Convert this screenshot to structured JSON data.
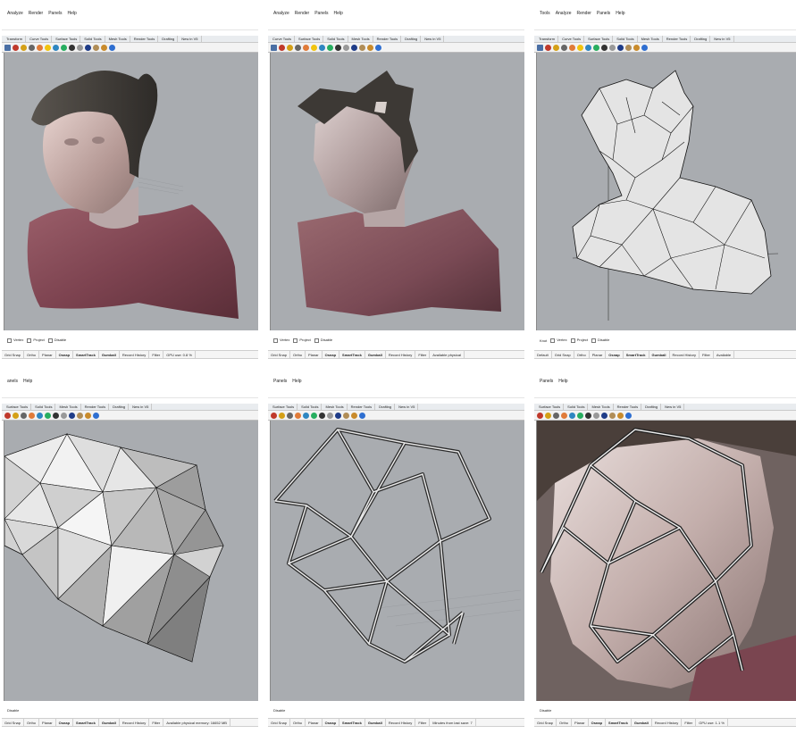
{
  "panels": [
    {
      "menu": [
        "Analyze",
        "Render",
        "Panels",
        "Help"
      ],
      "tabs": [
        "Transform",
        "Curve Tools",
        "Surface Tools",
        "Solid Tools",
        "Mesh Tools",
        "Render Tools",
        "Drafting",
        "New in V5"
      ],
      "osnap": [
        "Vertex",
        "Project",
        "Disable"
      ],
      "status": [
        "Grid Snap",
        "Ortho",
        "Planar",
        "Osnap",
        "SmartTrack",
        "Gumball",
        "Record History",
        "Filter",
        "GPU use: 0.8 %"
      ]
    },
    {
      "menu": [
        "Analyze",
        "Render",
        "Panels",
        "Help"
      ],
      "tabs": [
        "Curve Tools",
        "Surface Tools",
        "Solid Tools",
        "Mesh Tools",
        "Render Tools",
        "Drafting",
        "New in V5"
      ],
      "osnap": [
        "Vertex",
        "Project",
        "Disable"
      ],
      "status": [
        "Grid Snap",
        "Ortho",
        "Planar",
        "Osnap",
        "SmartTrack",
        "Gumball",
        "Record History",
        "Filter",
        "Available physical"
      ]
    },
    {
      "menu": [
        "Tools",
        "Analyze",
        "Render",
        "Panels",
        "Help"
      ],
      "tabs": [
        "Transform",
        "Curve Tools",
        "Surface Tools",
        "Solid Tools",
        "Mesh Tools",
        "Render Tools",
        "Drafting",
        "New in V5"
      ],
      "osnap": [
        "Knot",
        "Vertex",
        "Project",
        "Disable"
      ],
      "status": [
        "Default",
        "Grid Snap",
        "Ortho",
        "Planar",
        "Osnap",
        "SmartTrack",
        "Gumball",
        "Record History",
        "Filter",
        "Available"
      ]
    },
    {
      "menu": [
        "anels",
        "Help"
      ],
      "tabs": [
        "Surface Tools",
        "Solid Tools",
        "Mesh Tools",
        "Render Tools",
        "Drafting",
        "New in V5"
      ],
      "osnap": [
        "Disable"
      ],
      "status": [
        "Grid Snap",
        "Ortho",
        "Planar",
        "Osnap",
        "SmartTrack",
        "Gumball",
        "Record History",
        "Filter",
        "Available physical memory: 16652 MB"
      ]
    },
    {
      "menu": [
        "Panels",
        "Help"
      ],
      "tabs": [
        "Surface Tools",
        "Solid Tools",
        "Mesh Tools",
        "Render Tools",
        "Drafting",
        "New in V5"
      ],
      "osnap": [
        "Disable"
      ],
      "status": [
        "Grid Snap",
        "Ortho",
        "Planar",
        "Osnap",
        "SmartTrack",
        "Gumball",
        "Record History",
        "Filter",
        "Minutes from last save: 7"
      ]
    },
    {
      "menu": [
        "Panels",
        "Help"
      ],
      "tabs": [
        "Surface Tools",
        "Solid Tools",
        "Mesh Tools",
        "Render Tools",
        "Drafting",
        "New in V5"
      ],
      "osnap": [
        "Disable"
      ],
      "status": [
        "Grid Snap",
        "Ortho",
        "Planar",
        "Osnap",
        "SmartTrack",
        "Gumball",
        "Record History",
        "Filter",
        "GPU use: 1.1 %"
      ]
    }
  ],
  "colors": {
    "viewport_bg": "#a9acb0",
    "shirt": "#8a4e5a",
    "skin": "#c9b6b4",
    "hair": "#4a4540",
    "mesh_face": "#e8e8e8",
    "mesh_edge": "#1a1a1a"
  }
}
